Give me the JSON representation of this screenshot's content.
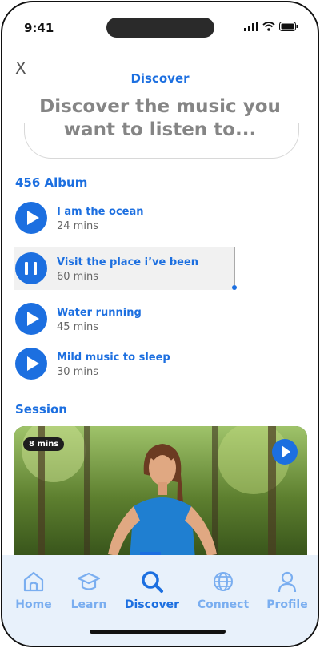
{
  "status": {
    "time": "9:41"
  },
  "header": {
    "close_label": "X",
    "title": "Discover",
    "headline": "Discover the music you want to listen to..."
  },
  "albums": {
    "heading": "456 Album",
    "items": [
      {
        "name": "I am the ocean",
        "duration": "24 mins",
        "state": "play"
      },
      {
        "name": "Visit the place i’ve been",
        "duration": "60 mins",
        "state": "pause"
      },
      {
        "name": "Water running",
        "duration": "45 mins",
        "state": "play"
      },
      {
        "name": "Mild music to sleep",
        "duration": "30 mins",
        "state": "play"
      }
    ]
  },
  "session": {
    "heading": "Session",
    "card": {
      "duration_badge": "8 mins"
    }
  },
  "nav": {
    "items": [
      {
        "label": "Home",
        "icon": "home-icon"
      },
      {
        "label": "Learn",
        "icon": "graduation-cap-icon"
      },
      {
        "label": "Discover",
        "icon": "search-icon",
        "active": true
      },
      {
        "label": "Connect",
        "icon": "globe-icon"
      },
      {
        "label": "Profile",
        "icon": "user-icon"
      }
    ]
  },
  "colors": {
    "accent": "#1c6fe0",
    "nav_bg": "#e8f1fb",
    "muted": "#858585"
  }
}
